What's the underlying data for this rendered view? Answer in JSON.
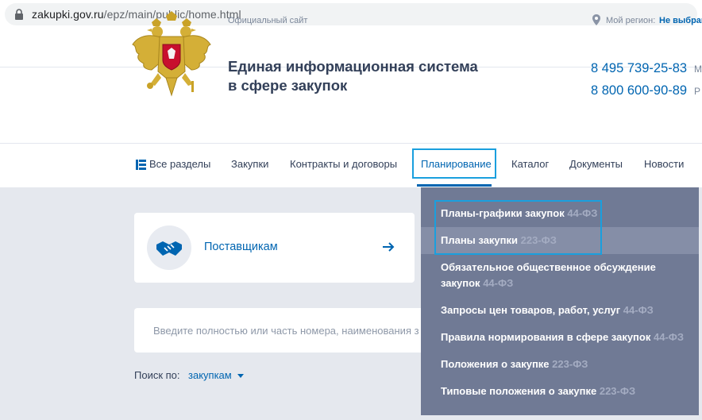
{
  "browser": {
    "url_domain": "zakupki.gov.ru",
    "url_path": "/epz/main/public/home.html"
  },
  "header": {
    "official_site": "Официальный сайт",
    "region_label": "Мой регион:",
    "region_value": "Не выбран",
    "title_line1": "Единая информационная система",
    "title_line2": "в сфере закупок",
    "phone1": "8 495 739-25-83",
    "phone2": "8 800 600-90-89",
    "phone1_tail": "М",
    "phone2_tail": "Р"
  },
  "nav": {
    "items": [
      "Все разделы",
      "Закупки",
      "Контракты и договоры",
      "Планирование",
      "Каталог",
      "Документы",
      "Новости"
    ],
    "active": "Планирование"
  },
  "main": {
    "card_label": "Поставщикам",
    "search_placeholder": "Введите полностью или часть номера, наименования з",
    "search_by_label": "Поиск по:",
    "search_by_value": "закупкам"
  },
  "dropdown": {
    "items": [
      {
        "label": "Планы-графики закупок",
        "law": "44-ФЗ"
      },
      {
        "label": "Планы закупки",
        "law": "223-ФЗ"
      },
      {
        "label_line1": "Обязательное общественное обсуждение",
        "label_line2": "закупок",
        "law": "44-ФЗ"
      },
      {
        "label": "Запросы цен товаров, работ, услуг",
        "law": "44-ФЗ"
      },
      {
        "label": "Правила нормирования в сфере закупок",
        "law": "44-ФЗ"
      },
      {
        "label": "Положения о закупке",
        "law": "223-ФЗ"
      },
      {
        "label": "Типовые положения о закупке",
        "law": "223-ФЗ"
      }
    ]
  },
  "colors": {
    "brand_blue": "#0065b1",
    "highlight": "#1a9fde",
    "dropdown_bg": "#707a95"
  }
}
